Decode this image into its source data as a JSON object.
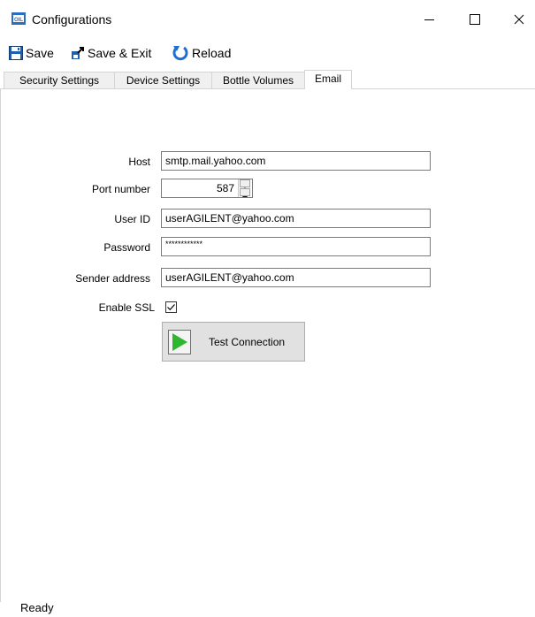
{
  "window": {
    "title": "Configurations",
    "app_icon": "app-oil-icon",
    "controls": [
      "minimize-icon",
      "maximize-icon",
      "close-icon"
    ]
  },
  "toolbar": {
    "save_label": "Save",
    "save_exit_label": "Save & Exit",
    "reload_label": "Reload"
  },
  "tabs": [
    {
      "label": "Security Settings",
      "active": false
    },
    {
      "label": "Device Settings",
      "active": false
    },
    {
      "label": "Bottle Volumes",
      "active": false
    },
    {
      "label": "Email",
      "active": true
    }
  ],
  "email_form": {
    "host": {
      "label": "Host",
      "value": "smtp.mail.yahoo.com"
    },
    "port": {
      "label": "Port number",
      "value": "587"
    },
    "user_id": {
      "label": "User ID",
      "value": "userAGILENT@yahoo.com"
    },
    "password": {
      "label": "Password",
      "value": "************"
    },
    "sender": {
      "label": "Sender address",
      "value": "userAGILENT@yahoo.com"
    },
    "ssl": {
      "label": "Enable SSL",
      "checked": true
    },
    "test_button_label": "Test Connection"
  },
  "status_text": "Ready"
}
